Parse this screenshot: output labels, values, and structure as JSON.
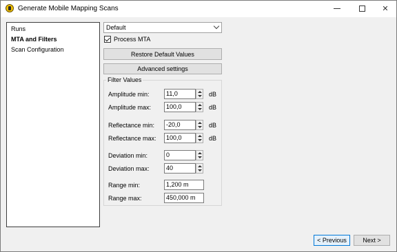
{
  "window": {
    "title": "Generate Mobile Mapping Scans",
    "icon": "app-icon"
  },
  "nav": {
    "items": [
      {
        "label": "Runs",
        "active": false
      },
      {
        "label": "MTA and Filters",
        "active": true
      },
      {
        "label": "Scan Configuration",
        "active": false
      }
    ]
  },
  "preset": {
    "value": "Default"
  },
  "process_mta": {
    "label": "Process MTA",
    "checked": true
  },
  "buttons": {
    "restore": "Restore Default Values",
    "advanced": "Advanced settings",
    "previous": "< Previous",
    "next": "Next >"
  },
  "filter": {
    "title": "Filter Values",
    "fields": [
      {
        "label": "Amplitude min:",
        "value": "11,0",
        "unit": "dB"
      },
      {
        "label": "Amplitude max:",
        "value": "100,0",
        "unit": "dB"
      },
      {
        "label": "Reflectance min:",
        "value": "-20,0",
        "unit": "dB"
      },
      {
        "label": "Reflectance max:",
        "value": "100,0",
        "unit": "dB"
      },
      {
        "label": "Deviation min:",
        "value": "0",
        "unit": ""
      },
      {
        "label": "Deviation max:",
        "value": "40",
        "unit": ""
      },
      {
        "label": "Range min:",
        "value": "1,200 m",
        "unit": ""
      },
      {
        "label": "Range max:",
        "value": "450,000 m",
        "unit": ""
      }
    ]
  }
}
